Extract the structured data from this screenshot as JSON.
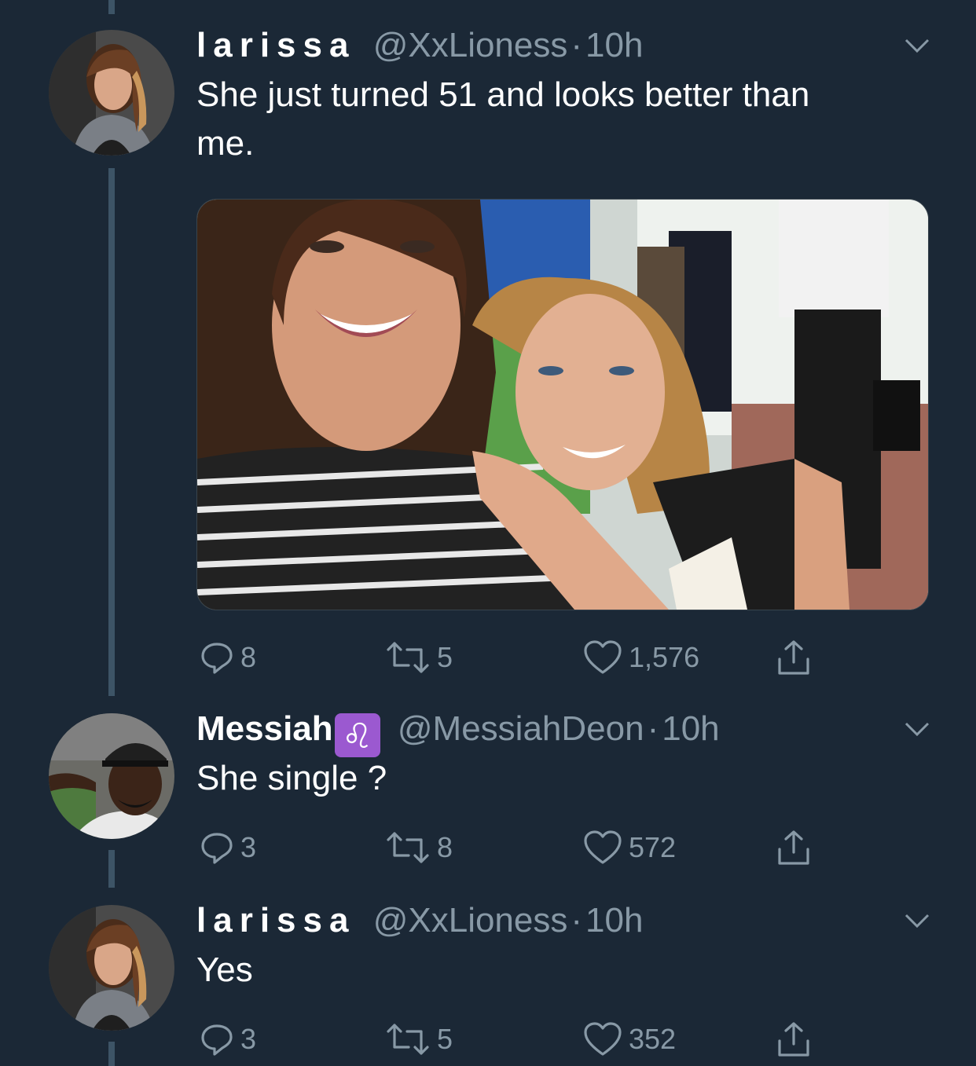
{
  "tweets": [
    {
      "name": "larissa",
      "handle": "@XxLioness",
      "separator": "·",
      "time": "10h",
      "text_line1": "She just turned 51 and looks better than",
      "text_line2": "me.",
      "has_media": true,
      "replies": "8",
      "retweets": "5",
      "likes": "1,576"
    },
    {
      "name": "Messiah",
      "name_emoji": "♌",
      "handle": "@MessiahDeon",
      "separator": "·",
      "time": "10h",
      "text_line1": "She single ?",
      "replies": "3",
      "retweets": "8",
      "likes": "572"
    },
    {
      "name": "larissa",
      "handle": "@XxLioness",
      "separator": "·",
      "time": "10h",
      "text_line1": "Yes",
      "replies": "3",
      "retweets": "5",
      "likes": "352"
    }
  ],
  "icons": {
    "reply": "reply-icon",
    "retweet": "retweet-icon",
    "like": "heart-icon",
    "share": "share-icon",
    "menu": "chevron-down-icon"
  },
  "colors": {
    "background": "#1b2836",
    "secondary_text": "#8899a6",
    "thread_line": "#3d5466",
    "zodiac_badge": "#9b59d0"
  }
}
